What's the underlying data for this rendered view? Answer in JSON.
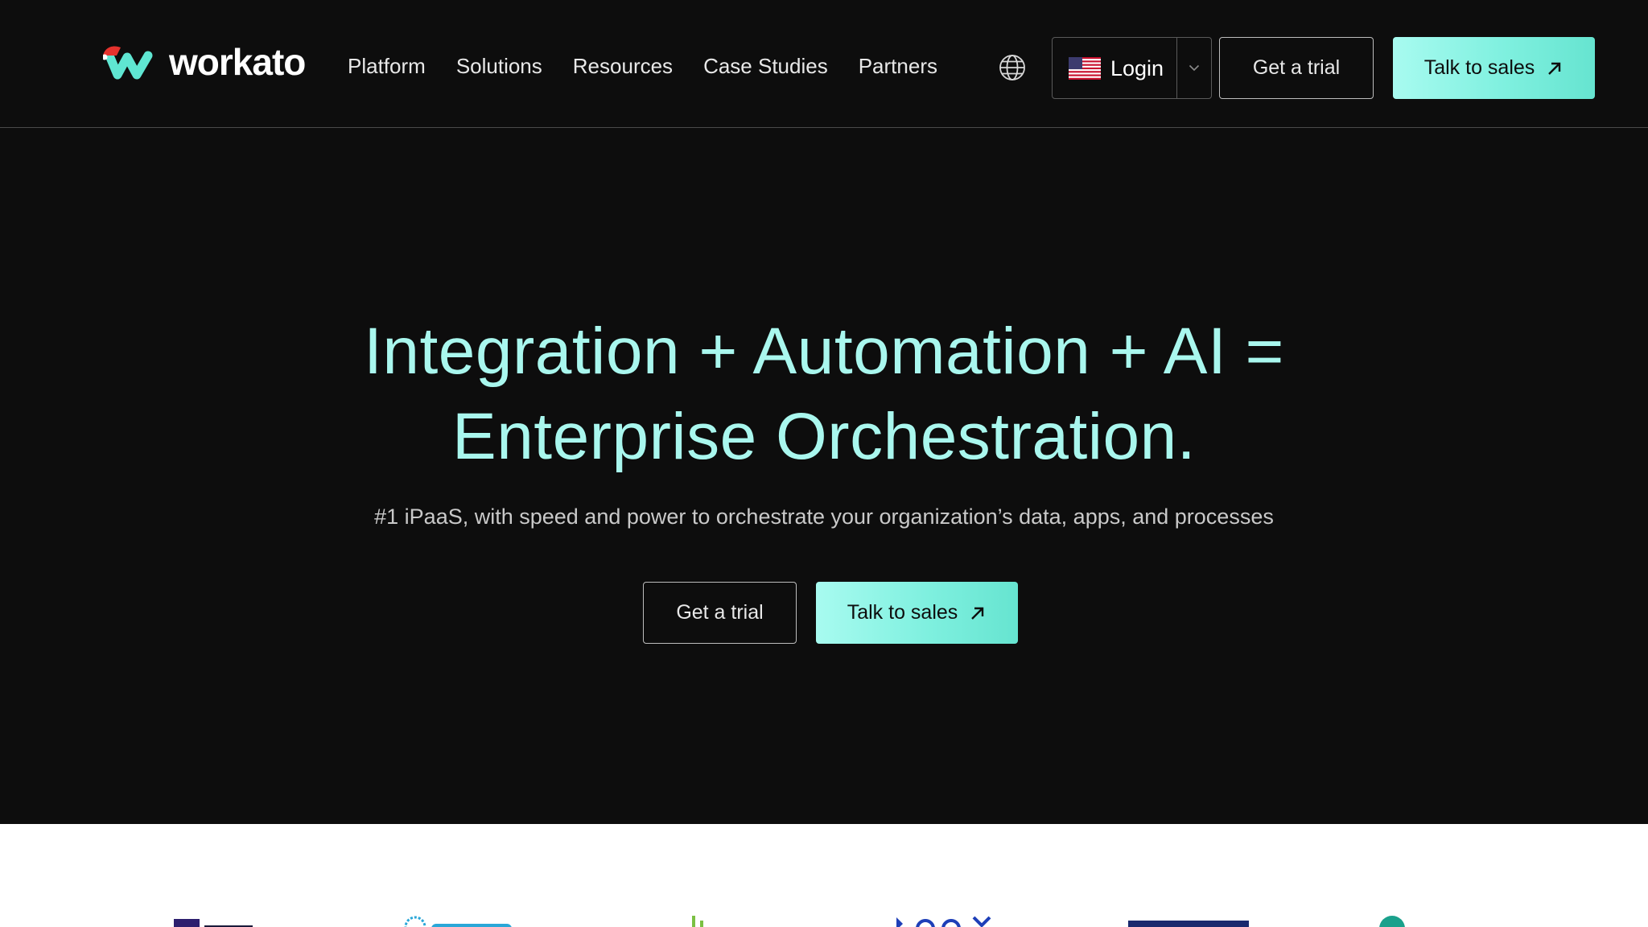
{
  "header": {
    "brand": "workato",
    "nav": [
      "Platform",
      "Solutions",
      "Resources",
      "Case Studies",
      "Partners"
    ],
    "login_label": "Login",
    "trial_label": "Get a trial",
    "sales_label": "Talk to sales"
  },
  "hero": {
    "title_line1": "Integration + Automation + AI =",
    "title_line2": "Enterprise Orchestration.",
    "subtitle": "#1 iPaaS, with speed and power to orchestrate your organization’s data, apps, and processes",
    "trial_label": "Get a trial",
    "sales_label": "Talk to sales"
  },
  "icons": {
    "globe": "globe-icon",
    "flag": "us-flag-icon",
    "caret": "chevron-down-icon",
    "arrow": "arrow-up-right-icon"
  },
  "colors": {
    "background": "#0d0d0d",
    "accent": "#7ff0df",
    "hero_text": "#a9f7ee",
    "logo_mark": "#5fe6d2",
    "santa_hat": "#e5322d"
  }
}
